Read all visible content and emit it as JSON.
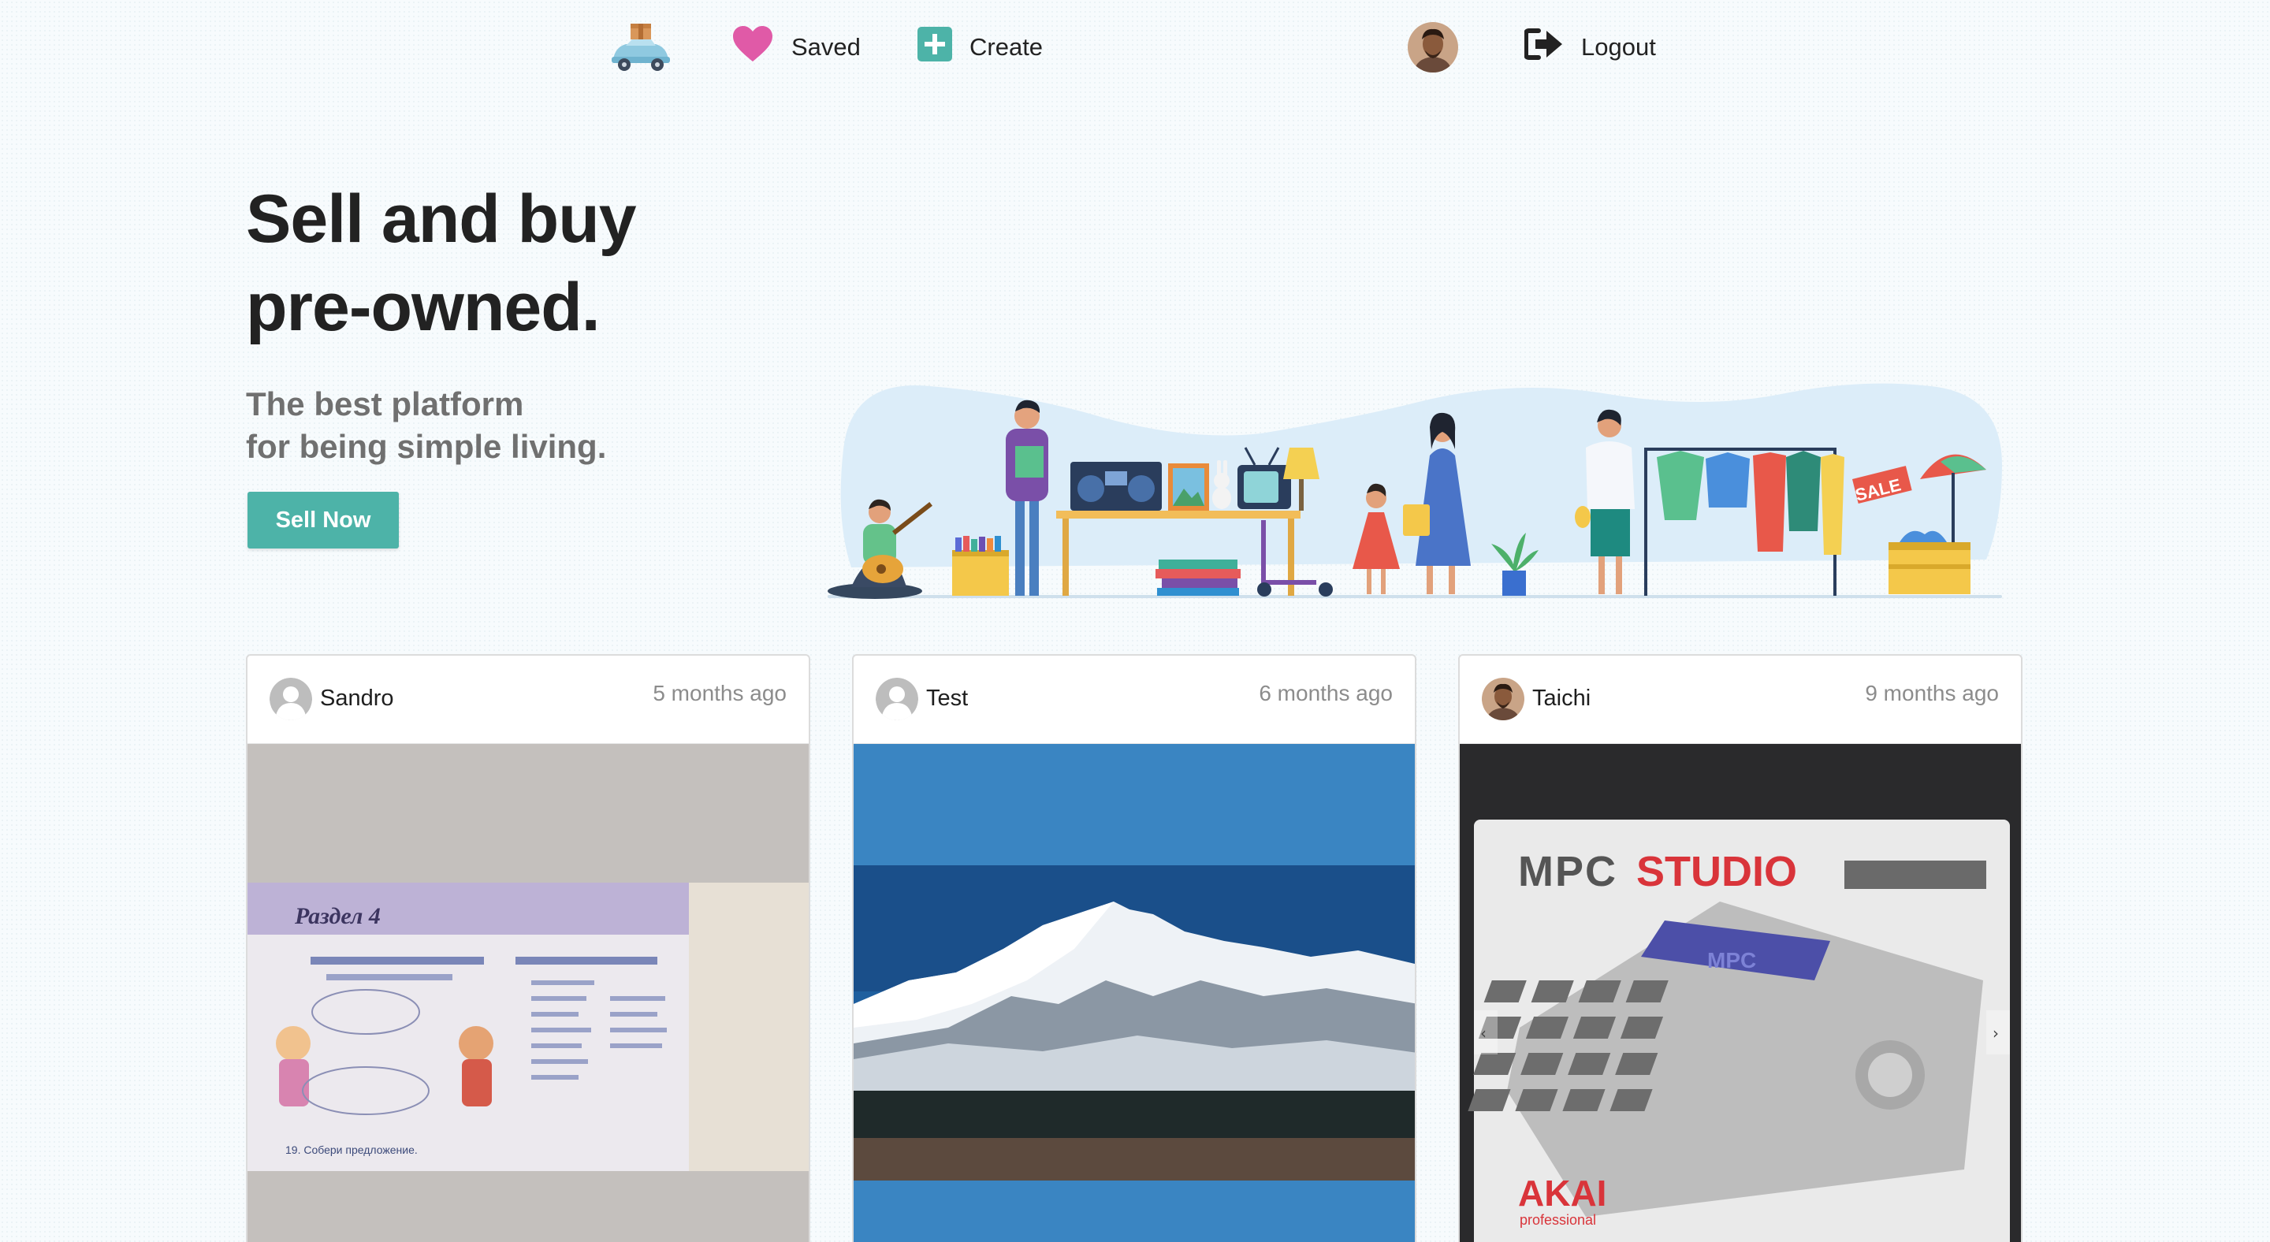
{
  "nav": {
    "logo_icon": "car-with-box-icon",
    "saved_label": "Saved",
    "saved_icon": "heart-icon",
    "create_label": "Create",
    "create_icon": "plus-square-icon",
    "logout_label": "Logout",
    "logout_icon": "sign-out-icon"
  },
  "hero": {
    "title_line1": "Sell and buy",
    "title_line2": "pre-owned.",
    "subtitle_line1": "The best platform",
    "subtitle_line2": "for being simple living.",
    "cta_label": "Sell Now",
    "sale_tag": "SALE"
  },
  "colors": {
    "accent": "#4db3a8",
    "heart": "#e05aa7",
    "create": "#4db3a8"
  },
  "cards": [
    {
      "user": "Sandro",
      "time": "5 months ago",
      "avatar": "default-avatar-icon",
      "book_heading": "Раздел 4",
      "book_caption": "19. Собери предложение."
    },
    {
      "user": "Test",
      "time": "6 months ago",
      "avatar": "default-avatar-icon"
    },
    {
      "user": "Taichi",
      "time": "9 months ago",
      "avatar": "user-photo",
      "product_brand": "MPC",
      "product_model": "STUDIO",
      "product_screen": "MPC",
      "product_maker": "AKAI",
      "product_maker_sub": "professional"
    }
  ]
}
